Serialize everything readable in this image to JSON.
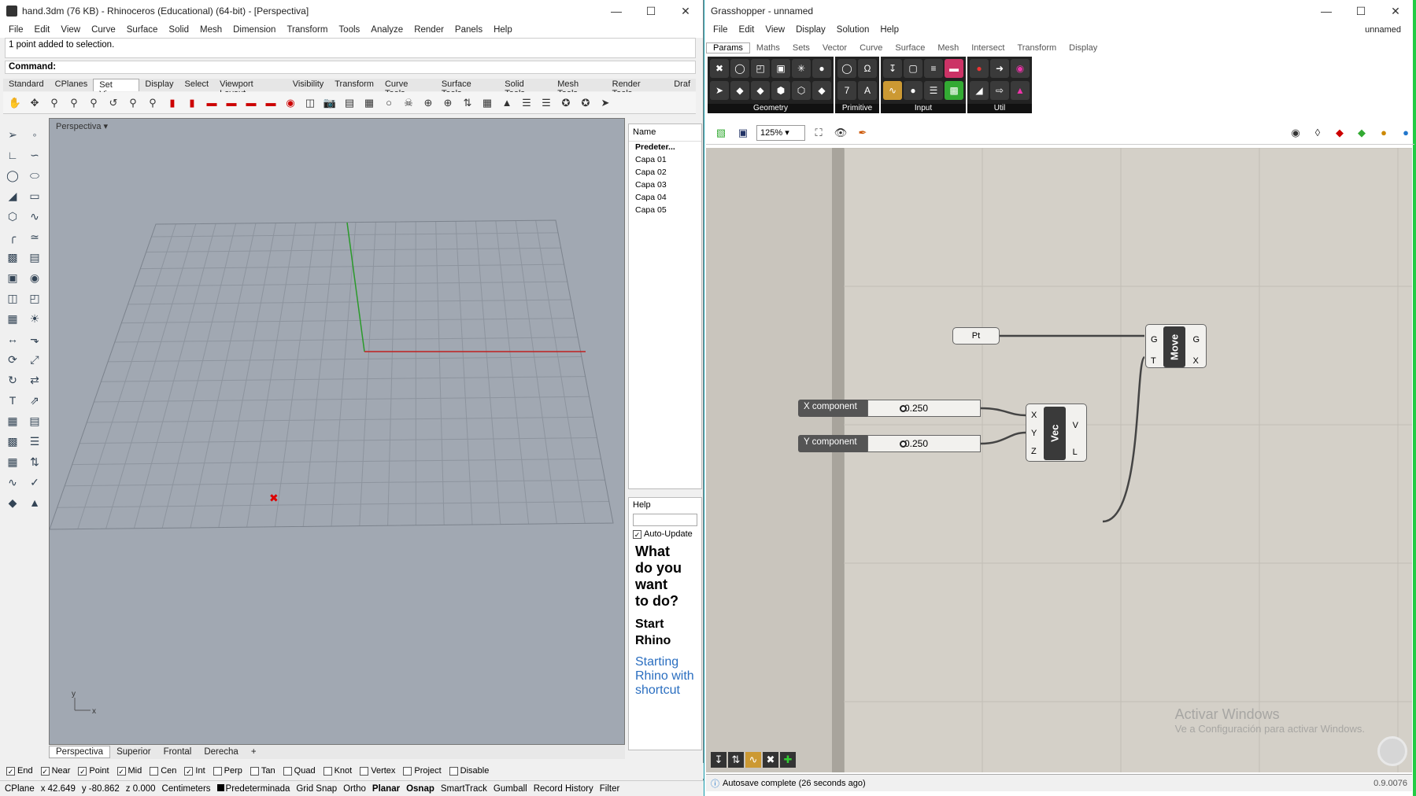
{
  "rhino": {
    "title": "hand.3dm (76 KB) - Rhinoceros (Educational) (64-bit) - [Perspectiva]",
    "menu": [
      "File",
      "Edit",
      "View",
      "Curve",
      "Surface",
      "Solid",
      "Mesh",
      "Dimension",
      "Transform",
      "Tools",
      "Analyze",
      "Render",
      "Panels",
      "Help"
    ],
    "history": "1 point added to selection.",
    "command_label": "Command:",
    "toolbar_tabs": [
      "Standard",
      "CPlanes",
      "Set View",
      "Display",
      "Select",
      "Viewport Layout",
      "Visibility",
      "Transform",
      "Curve Tools",
      "Surface Tools",
      "Solid Tools",
      "Mesh Tools",
      "Render Tools",
      "Draf"
    ],
    "active_toolbar_tab": "Set View",
    "viewport_title": "Perspectiva",
    "axis_label_x": "x",
    "axis_label_y": "y",
    "viewport_tabs": [
      "Perspectiva",
      "Superior",
      "Frontal",
      "Derecha"
    ],
    "layers_header": "Name",
    "layers": [
      "Predeter...",
      "Capa 01",
      "Capa 02",
      "Capa 03",
      "Capa 04",
      "Capa 05"
    ],
    "help": {
      "title": "Help",
      "auto_update": "Auto-Update",
      "question": "What do you want to do?",
      "start": "Start Rhino",
      "link": "Starting Rhino with shortcut"
    },
    "osnaps": [
      {
        "label": "End",
        "checked": true
      },
      {
        "label": "Near",
        "checked": true
      },
      {
        "label": "Point",
        "checked": true
      },
      {
        "label": "Mid",
        "checked": true
      },
      {
        "label": "Cen",
        "checked": false
      },
      {
        "label": "Int",
        "checked": true
      },
      {
        "label": "Perp",
        "checked": false
      },
      {
        "label": "Tan",
        "checked": false
      },
      {
        "label": "Quad",
        "checked": false
      },
      {
        "label": "Knot",
        "checked": false
      },
      {
        "label": "Vertex",
        "checked": false
      },
      {
        "label": "Project",
        "checked": false
      },
      {
        "label": "Disable",
        "checked": false
      }
    ],
    "status": {
      "cplane": "CPlane",
      "x": "x 42.649",
      "y": "y -80.862",
      "z": "z 0.000",
      "units": "Centimeters",
      "layer": "Predeterminada",
      "grid_snap": "Grid Snap",
      "ortho": "Ortho",
      "planar": "Planar",
      "osnap": "Osnap",
      "smarttrack": "SmartTrack",
      "gumball": "Gumball",
      "record_history": "Record History",
      "filter": "Filter"
    }
  },
  "grasshopper": {
    "title": "Grasshopper - unnamed",
    "doc_name": "unnamed",
    "menu": [
      "File",
      "Edit",
      "View",
      "Display",
      "Solution",
      "Help"
    ],
    "tabs": [
      "Params",
      "Maths",
      "Sets",
      "Vector",
      "Curve",
      "Surface",
      "Mesh",
      "Intersect",
      "Transform",
      "Display"
    ],
    "active_tab": "Params",
    "groups": [
      "Geometry",
      "Primitive",
      "Input",
      "Util"
    ],
    "zoom": "125%",
    "components": {
      "pt": "Pt",
      "move": "Move",
      "move_in": [
        "G",
        "T"
      ],
      "move_out": [
        "G",
        "X"
      ],
      "vec": "Vec",
      "vec_in": [
        "X",
        "Y",
        "Z"
      ],
      "vec_out": [
        "V",
        "L"
      ]
    },
    "sliders": [
      {
        "label": "X component",
        "value": "0.250"
      },
      {
        "label": "Y component",
        "value": "0.250"
      }
    ],
    "watermark_title": "Activar Windows",
    "watermark_sub": "Ve a Configuración para activar Windows.",
    "status": "Autosave complete (26 seconds ago)",
    "version": "0.9.0076"
  }
}
